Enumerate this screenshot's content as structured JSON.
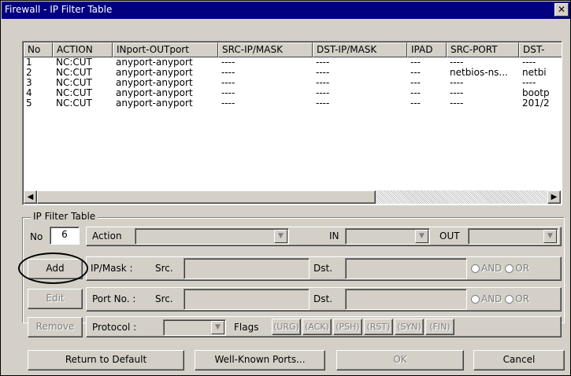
{
  "window": {
    "title": "Firewall - IP Filter Table",
    "close_glyph": "✕"
  },
  "list": {
    "columns": [
      "No",
      "ACTION",
      "INport-OUTport",
      "SRC-IP/MASK",
      "DST-IP/MASK",
      "IPAD",
      "SRC-PORT",
      "DST-"
    ],
    "rows": [
      [
        "1",
        "NC:CUT",
        "anyport-anyport",
        "----",
        "----",
        "---",
        "----",
        "----"
      ],
      [
        "2",
        "NC:CUT",
        "anyport-anyport",
        "----",
        "----",
        "---",
        "netbios-ns...",
        "netbi"
      ],
      [
        "3",
        "NC:CUT",
        "anyport-anyport",
        "----",
        "----",
        "---",
        "----",
        "----"
      ],
      [
        "4",
        "NC:CUT",
        "anyport-anyport",
        "----",
        "----",
        "---",
        "----",
        "bootp"
      ],
      [
        "5",
        "NC:CUT",
        "anyport-anyport",
        "----",
        "----",
        "---",
        "----",
        "201/2"
      ]
    ],
    "scroll_left": "◀",
    "scroll_right": "▶"
  },
  "group": {
    "title": "IP Filter Table",
    "no_label": "No",
    "no_value": "6",
    "action_label": "Action",
    "in_label": "IN",
    "out_label": "OUT",
    "ipmask_label": "IP/Mask :",
    "src_label": "Src.",
    "dst_label": "Dst.",
    "port_label": "Port No. :",
    "and_label": "AND",
    "or_label": "OR",
    "protocol_label": "Protocol :",
    "flags_label": "Flags",
    "flags": [
      "(URG)",
      "(ACK)",
      "(PSH)",
      "(RST)",
      "(SYN)",
      "(FIN)"
    ],
    "add": "Add",
    "edit": "Edit",
    "remove": "Remove"
  },
  "bottom": {
    "return": "Return to Default",
    "wellknown": "Well-Known Ports...",
    "ok": "OK",
    "cancel": "Cancel"
  }
}
